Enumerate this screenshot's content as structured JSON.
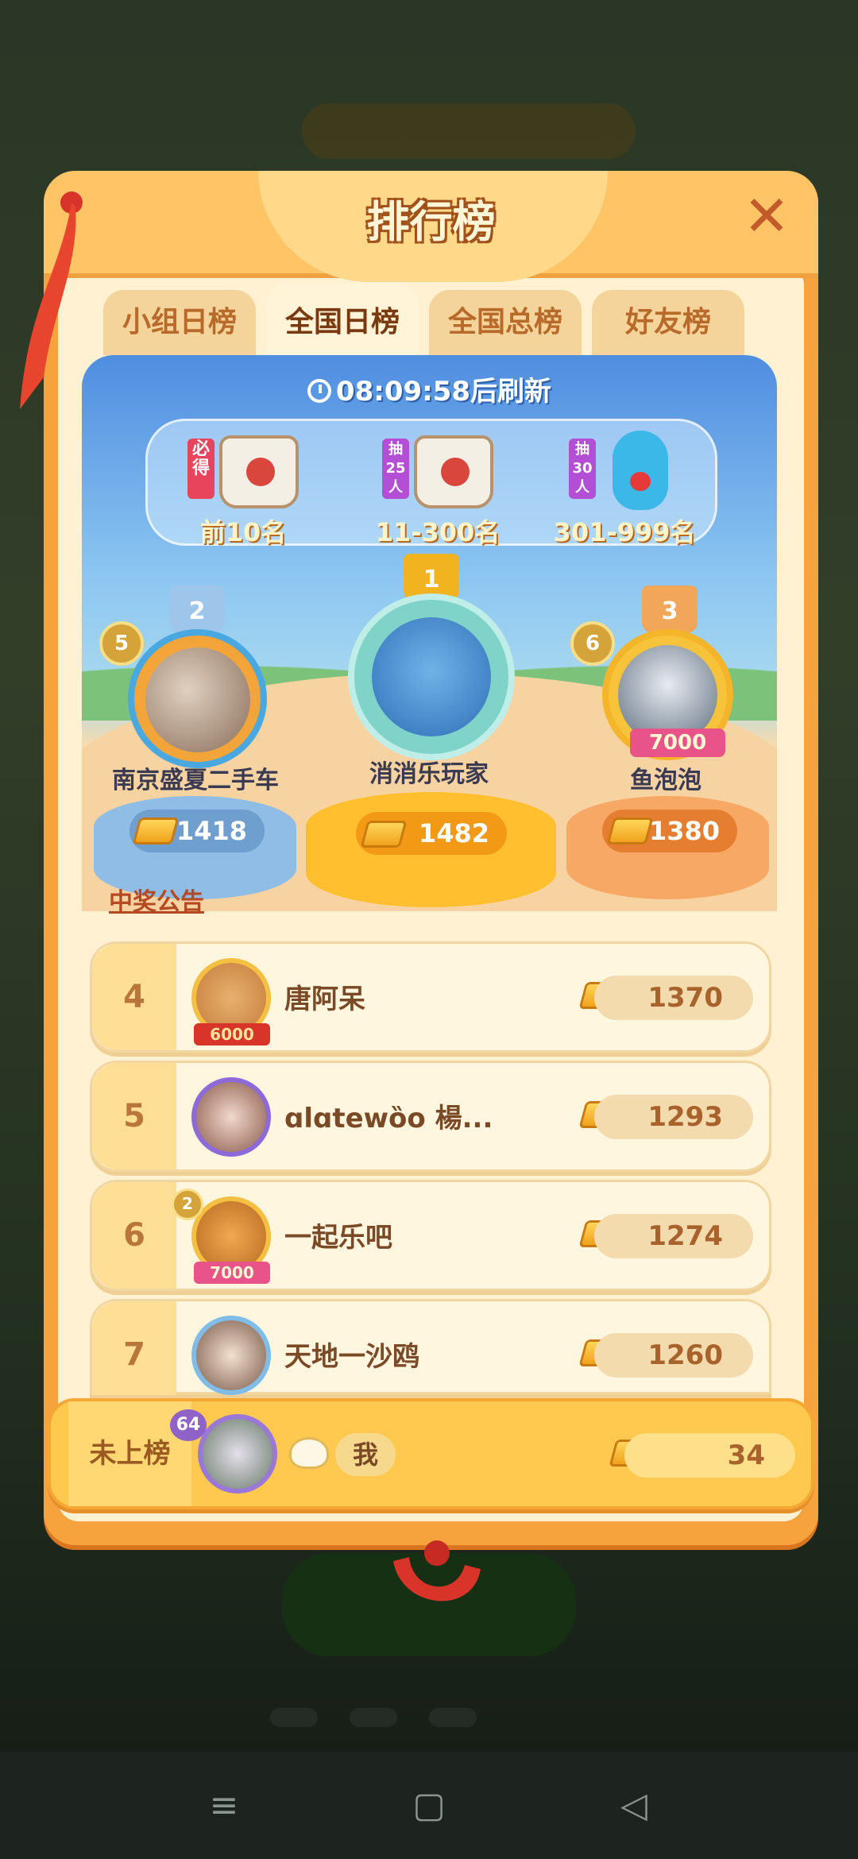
{
  "app": {
    "title": "排行榜"
  },
  "tabs": [
    {
      "label": "小组日榜",
      "active": false
    },
    {
      "label": "全国日榜",
      "active": true
    },
    {
      "label": "全国总榜",
      "active": false
    },
    {
      "label": "好友榜",
      "active": false
    }
  ],
  "timer": {
    "text": "08:09:58后刷新"
  },
  "prizes": [
    {
      "tag": "必得",
      "range": "前10名",
      "item": "bag-icon",
      "tag_color": "#e8445c"
    },
    {
      "tag": "抽25人",
      "range": "11-300名",
      "item": "bag-icon",
      "tag_color": "#b24fd4"
    },
    {
      "tag": "抽30人",
      "range": "301-999名",
      "item": "bear-icon",
      "tag_color": "#b24fd4"
    }
  ],
  "podium": {
    "first": {
      "rank": "1",
      "name": "消消乐玩家",
      "score": "1482"
    },
    "second": {
      "rank": "2",
      "name": "南京盛夏二手车",
      "score": "1418",
      "level": "5"
    },
    "third": {
      "rank": "3",
      "name": "鱼泡泡",
      "score": "1380",
      "level": "6",
      "frame_value": "7000"
    }
  },
  "announcement": {
    "label": "中奖公告"
  },
  "rows": [
    {
      "rank": "4",
      "name": "唐阿呆",
      "score": "1370",
      "frame_value": "6000"
    },
    {
      "rank": "5",
      "name": "ɑlɑtewȍo 楊...",
      "score": "1293"
    },
    {
      "rank": "6",
      "name": "一起乐吧",
      "score": "1274",
      "frame_value": "7000",
      "level": "2"
    },
    {
      "rank": "7",
      "name": "天地一沙鸥",
      "score": "1260"
    }
  ],
  "me": {
    "rank_label": "未上榜",
    "level": "64",
    "name": "我",
    "score": "34"
  },
  "colors": {
    "panel": "#f6a23d",
    "gold": "#f0a21c",
    "accent_text": "#b54a22"
  },
  "navbar": {
    "menu_icon": "≡",
    "home_icon": "▢",
    "back_icon": "◁"
  }
}
